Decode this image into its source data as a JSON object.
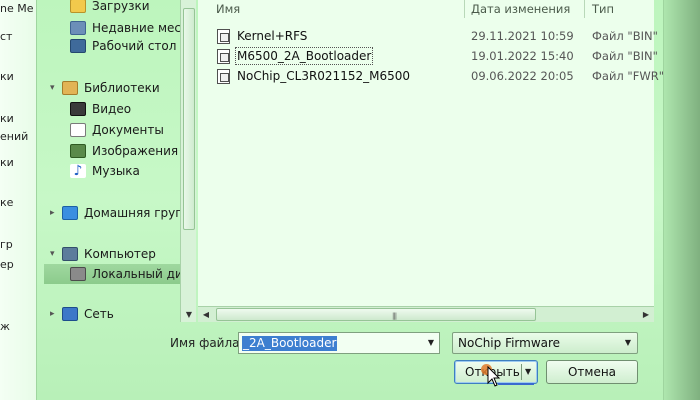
{
  "desktop": {
    "fragments": [
      "ne Me",
      "ст",
      "ки",
      "ки",
      "ений",
      "ки",
      "ке",
      "гр",
      "ер",
      "ж"
    ]
  },
  "nav": {
    "items": [
      {
        "label": "Загрузки",
        "icon": "downloads-icon",
        "kind": "sub"
      },
      {
        "label": "Недавние места",
        "icon": "recent-places-icon",
        "kind": "sub"
      },
      {
        "label": "Рабочий стол",
        "icon": "desktop-icon",
        "kind": "sub"
      },
      {
        "label": "Библиотеки",
        "icon": "libraries-icon",
        "kind": "root"
      },
      {
        "label": "Видео",
        "icon": "video-icon",
        "kind": "sub"
      },
      {
        "label": "Документы",
        "icon": "documents-icon",
        "kind": "sub"
      },
      {
        "label": "Изображения",
        "icon": "pictures-icon",
        "kind": "sub"
      },
      {
        "label": "Музыка",
        "icon": "music-icon",
        "kind": "sub"
      },
      {
        "label": "Домашняя группа",
        "icon": "homegroup-icon",
        "kind": "root"
      },
      {
        "label": "Компьютер",
        "icon": "computer-icon",
        "kind": "root"
      },
      {
        "label": "Локальный диск",
        "icon": "local-disk-icon",
        "kind": "selected"
      },
      {
        "label": "Сеть",
        "icon": "network-icon",
        "kind": "root"
      }
    ]
  },
  "files": {
    "columns": {
      "name": "Имя",
      "date": "Дата изменения",
      "type": "Тип"
    },
    "rows": [
      {
        "name": "Kernel+RFS",
        "date": "29.11.2021 10:59",
        "type": "Файл \"BIN\""
      },
      {
        "name": "M6500_2A_Bootloader",
        "date": "19.01.2022 15:40",
        "type": "Файл \"BIN\""
      },
      {
        "name": "NoChip_CL3R021152_M6500",
        "date": "09.06.2022 20:05",
        "type": "Файл \"FWR\""
      }
    ]
  },
  "bottom": {
    "filename_label": "Имя файла:",
    "filename_value": "_2A_Bootloader",
    "filter_value": "NoChip Firmware",
    "open_label": "Открыть",
    "cancel_label": "Отмена"
  }
}
